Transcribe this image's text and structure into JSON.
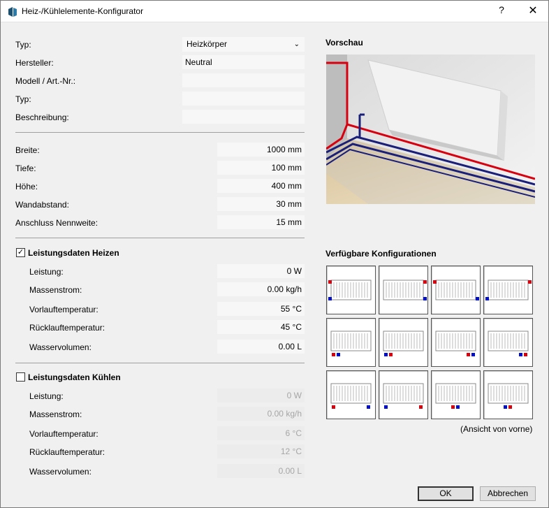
{
  "window": {
    "title": "Heiz-/Kühlelemente-Konfigurator",
    "help": "?",
    "close": "✕"
  },
  "general": {
    "typ_label": "Typ:",
    "typ_value": "Heizkörper",
    "hersteller_label": "Hersteller:",
    "hersteller_value": "Neutral",
    "modell_label": "Modell / Art.-Nr.:",
    "modell_value": "",
    "typ2_label": "Typ:",
    "typ2_value": "",
    "beschreibung_label": "Beschreibung:",
    "beschreibung_value": ""
  },
  "dimensions": {
    "breite_label": "Breite:",
    "breite_value": "1000 mm",
    "tiefe_label": "Tiefe:",
    "tiefe_value": "100 mm",
    "hoehe_label": "Höhe:",
    "hoehe_value": "400 mm",
    "wandabstand_label": "Wandabstand:",
    "wandabstand_value": "30 mm",
    "nennweite_label": "Anschluss Nennweite:",
    "nennweite_value": "15 mm"
  },
  "heizen": {
    "title": "Leistungsdaten Heizen",
    "checked": true,
    "leistung_label": "Leistung:",
    "leistung_value": "0 W",
    "massenstrom_label": "Massenstrom:",
    "massenstrom_value": "0.00 kg/h",
    "vorlauf_label": "Vorlauftemperatur:",
    "vorlauf_value": "55 °C",
    "ruecklauf_label": "Rücklauftemperatur:",
    "ruecklauf_value": "45 °C",
    "wasser_label": "Wasservolumen:",
    "wasser_value": "0.00 L"
  },
  "kuehlen": {
    "title": "Leistungsdaten Kühlen",
    "checked": false,
    "leistung_label": "Leistung:",
    "leistung_value": "0 W",
    "massenstrom_label": "Massenstrom:",
    "massenstrom_value": "0.00 kg/h",
    "vorlauf_label": "Vorlauftemperatur:",
    "vorlauf_value": "6 °C",
    "ruecklauf_label": "Rücklauftemperatur:",
    "ruecklauf_value": "12 °C",
    "wasser_label": "Wasservolumen:",
    "wasser_value": "0.00 L"
  },
  "preview": {
    "title": "Vorschau"
  },
  "configs": {
    "title": "Verfügbare Konfigurationen",
    "note": "(Ansicht von vorne)",
    "supply_color": "#d8000f",
    "return_color": "#0010c8",
    "items": [
      {
        "name": "side-left-top-bottom"
      },
      {
        "name": "side-right-top-bottom"
      },
      {
        "name": "cross-left-top-right-bottom"
      },
      {
        "name": "cross-right-top-left-bottom"
      },
      {
        "name": "bottom-left-pair"
      },
      {
        "name": "bottom-left-pair-reversed"
      },
      {
        "name": "bottom-right-pair"
      },
      {
        "name": "bottom-right-pair-reversed"
      },
      {
        "name": "bottom-both-ends"
      },
      {
        "name": "bottom-both-ends-reversed"
      },
      {
        "name": "bottom-center-pair"
      },
      {
        "name": "bottom-center-pair-reversed"
      }
    ]
  },
  "buttons": {
    "ok": "OK",
    "cancel": "Abbrechen"
  }
}
